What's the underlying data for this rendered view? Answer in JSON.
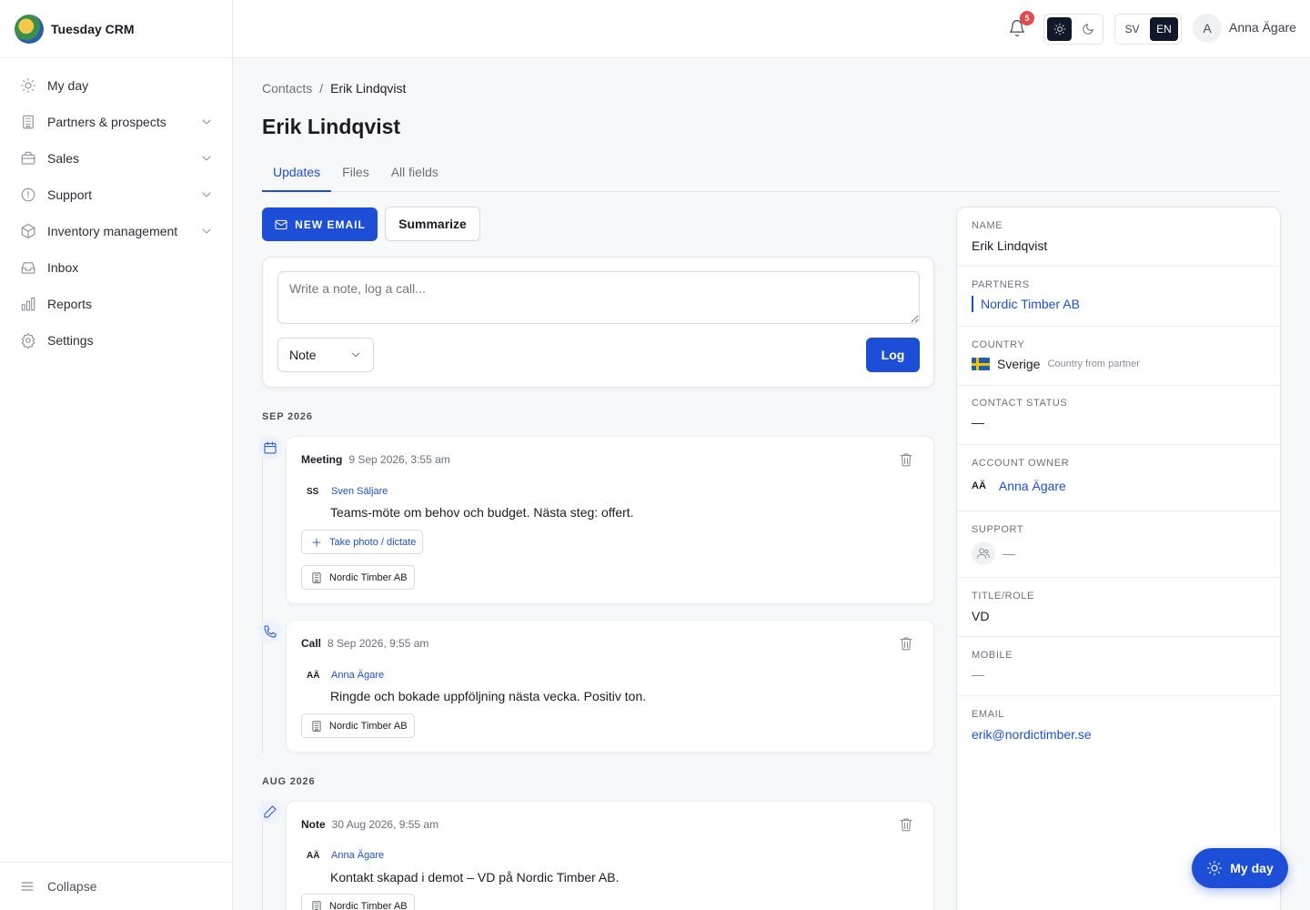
{
  "app": {
    "name": "Tuesday CRM"
  },
  "sidebar": {
    "items": [
      {
        "label": "My day",
        "icon": "sun-icon",
        "expandable": false
      },
      {
        "label": "Partners & prospects",
        "icon": "building-icon",
        "expandable": true
      },
      {
        "label": "Sales",
        "icon": "briefcase-icon",
        "expandable": true
      },
      {
        "label": "Support",
        "icon": "life-buoy-icon",
        "expandable": true
      },
      {
        "label": "Inventory management",
        "icon": "box-icon",
        "expandable": true
      },
      {
        "label": "Inbox",
        "icon": "inbox-icon",
        "expandable": false
      },
      {
        "label": "Reports",
        "icon": "bar-chart-icon",
        "expandable": false
      },
      {
        "label": "Settings",
        "icon": "gear-icon",
        "expandable": false
      }
    ],
    "collapse_label": "Collapse"
  },
  "topbar": {
    "notifications_count": "5",
    "languages": [
      "SV",
      "EN"
    ],
    "active_language": "EN",
    "user_initial": "A",
    "user_name": "Anna Ägare"
  },
  "breadcrumb": {
    "parent": "Contacts",
    "separator": "/",
    "current": "Erik Lindqvist"
  },
  "page": {
    "title": "Erik Lindqvist"
  },
  "tabs": [
    "Updates",
    "Files",
    "All fields"
  ],
  "actions": {
    "new_email": "NEW EMAIL",
    "summarize": "Summarize"
  },
  "composer": {
    "placeholder": "Write a note, log a call...",
    "type": "Note",
    "log_label": "Log"
  },
  "timeline": {
    "months": [
      "SEP 2026",
      "AUG 2026"
    ],
    "entries": [
      {
        "type": "Meeting",
        "date": "9 Sep 2026, 3:55 am",
        "author_initials": "SS",
        "author": "Sven Säljare",
        "text": "Teams-möte om behov och budget. Nästa steg: offert.",
        "action": "Take photo / dictate",
        "partner": "Nordic Timber AB"
      },
      {
        "type": "Call",
        "date": "8 Sep 2026, 9:55 am",
        "author_initials": "AÄ",
        "author": "Anna Ägare",
        "text": "Ringde och bokade uppföljning nästa vecka. Positiv ton.",
        "partner": "Nordic Timber AB"
      },
      {
        "type": "Note",
        "date": "30 Aug 2026, 9:55 am",
        "author_initials": "AÄ",
        "author": "Anna Ägare",
        "text": "Kontakt skapad i demot – VD på Nordic Timber AB.",
        "partner": "Nordic Timber AB"
      }
    ]
  },
  "details": {
    "name": {
      "label": "NAME",
      "value": "Erik Lindqvist"
    },
    "partners": {
      "label": "PARTNERS",
      "value": "Nordic Timber AB"
    },
    "country": {
      "label": "COUNTRY",
      "value": "Sverige",
      "hint": "Country from partner"
    },
    "contact_status": {
      "label": "CONTACT STATUS",
      "value": "—"
    },
    "account_owner": {
      "label": "ACCOUNT OWNER",
      "initials": "AÄ",
      "value": "Anna Ägare"
    },
    "support": {
      "label": "SUPPORT",
      "value": "—"
    },
    "title_role": {
      "label": "TITLE/ROLE",
      "value": "VD"
    },
    "mobile": {
      "label": "MOBILE",
      "value": "—"
    },
    "email": {
      "label": "EMAIL",
      "value": "erik@nordictimber.se"
    }
  },
  "fab": {
    "label": "My day"
  },
  "colors": {
    "accent": "#1d4ed8",
    "badge": "#e5484d",
    "dark": "#111827"
  }
}
